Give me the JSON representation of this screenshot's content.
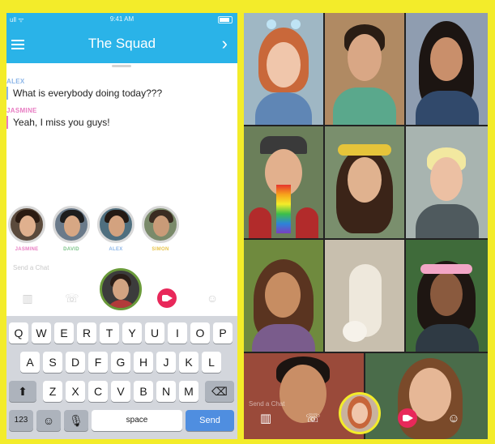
{
  "status_bar": {
    "time": "9:41 AM",
    "signal": "ull ᯤ"
  },
  "chat": {
    "title": "The Squad",
    "messages": [
      {
        "sender": "ALEX",
        "sender_color": "#8cb6e8",
        "text": "What is everybody doing today???"
      },
      {
        "sender": "JASMINE",
        "sender_color": "#e87cc2",
        "text": "Yeah, I miss you guys!"
      }
    ]
  },
  "participants": [
    {
      "name": "JASMINE",
      "color": "#e87cc2"
    },
    {
      "name": "DAVID",
      "color": "#7ec48a"
    },
    {
      "name": "ALEX",
      "color": "#8cb6e8"
    },
    {
      "name": "SIMON",
      "color": "#e8c34a"
    }
  ],
  "composer": {
    "placeholder": "Send a Chat"
  },
  "keyboard": {
    "row1": [
      "Q",
      "W",
      "E",
      "R",
      "T",
      "Y",
      "U",
      "I",
      "O",
      "P"
    ],
    "row2": [
      "A",
      "S",
      "D",
      "F",
      "G",
      "H",
      "J",
      "K",
      "L"
    ],
    "row3": [
      "Z",
      "X",
      "C",
      "V",
      "B",
      "N",
      "M"
    ],
    "numbers_key": "123",
    "space_key": "space",
    "send_key": "Send"
  },
  "group_video": {
    "composer_placeholder": "Send a Chat"
  },
  "colors": {
    "frame": "#f3ec2a",
    "header": "#2ab3e8",
    "video_button": "#e8285a",
    "send_key": "#4f8ee0"
  }
}
